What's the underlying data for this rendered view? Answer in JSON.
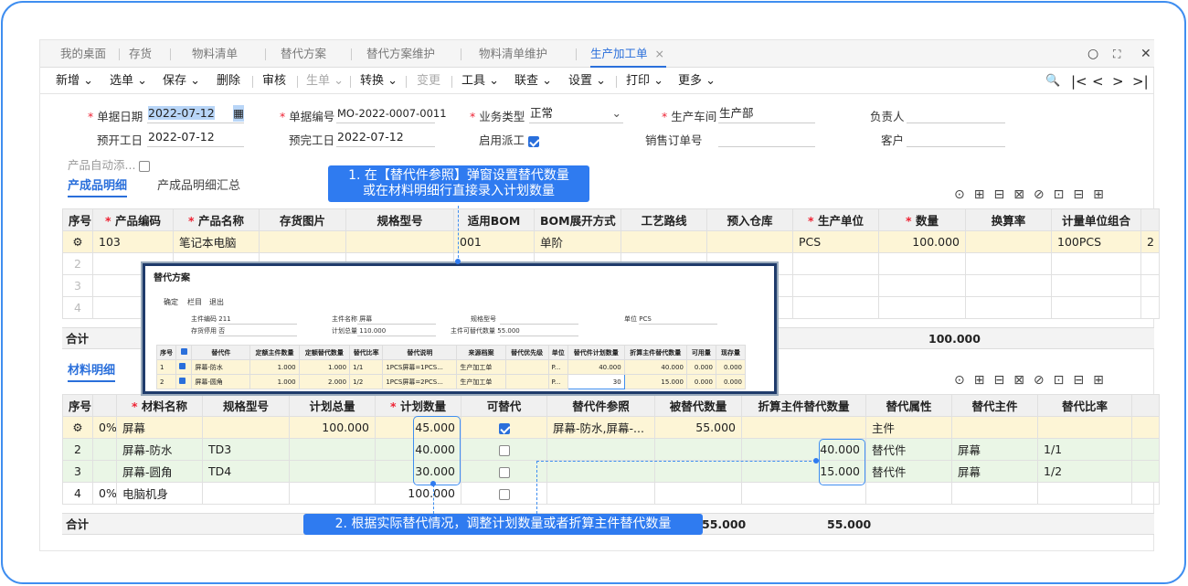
{
  "tabs": [
    {
      "label": "我的桌面"
    },
    {
      "label": "存货"
    },
    {
      "label": "物料清单"
    },
    {
      "label": "替代方案"
    },
    {
      "label": "替代方案维护"
    },
    {
      "label": "物料清单维护"
    },
    {
      "label": "生产加工单"
    }
  ],
  "tab_close": "×",
  "window_controls": {
    "search": "○",
    "maximize": "⛶",
    "close": "✕"
  },
  "toolbar": {
    "new": "新增 ⌄",
    "select": "选单 ⌄",
    "save": "保存 ⌄",
    "delete": "删除",
    "audit": "审核",
    "produce": "生单 ⌄",
    "convert": "转换 ⌄",
    "change": "变更",
    "tools": "工具 ⌄",
    "query": "联查 ⌄",
    "settings": "设置 ⌄",
    "print": "打印 ⌄",
    "more": "更多 ⌄"
  },
  "nav": {
    "find": "🔍",
    "first": "|<",
    "prev": "<",
    "next": ">",
    "last": ">|"
  },
  "form": {
    "doc_date_label": "单据日期",
    "doc_date": "2022-07-12",
    "calendar_icon": "▦",
    "doc_no_label": "单据编号",
    "doc_no": "MO-2022-0007-0011",
    "biz_type_label": "业务类型",
    "biz_type": "正常",
    "workshop_label": "生产车间",
    "workshop": "生产部",
    "owner_label": "负责人",
    "owner": "",
    "start_label": "预开工日",
    "start": "2022-07-12",
    "finish_label": "预完工日",
    "finish": "2022-07-12",
    "dispatch_label": "启用派工",
    "sales_order_label": "销售订单号",
    "sales_order": "",
    "customer_label": "客户",
    "customer": "",
    "auto_add_label": "产品自动添..."
  },
  "product_tabs": {
    "detail": "产成品明细",
    "summary": "产成品明细汇总"
  },
  "product_table": {
    "headers": [
      "序号",
      "产品编码",
      "产品名称",
      "存货图片",
      "规格型号",
      "适用BOM",
      "BOM展开方式",
      "工艺路线",
      "预入仓库",
      "生产单位",
      "数量",
      "换算率",
      "计量单位组合"
    ],
    "rows": [
      {
        "seq": "",
        "code": "103",
        "name": "笔记本电脑",
        "img": "",
        "spec": "",
        "bom": "001",
        "expand": "单阶",
        "route": "",
        "wh": "",
        "unit": "PCS",
        "qty": "100.000",
        "rate": "",
        "combo": "100PCS"
      },
      {
        "seq": "2"
      },
      {
        "seq": "3"
      },
      {
        "seq": "4"
      }
    ],
    "sum_label": "合计",
    "sum_qty": "100.000"
  },
  "popup": {
    "title": "替代方案",
    "buttons": [
      "确定",
      "栏目",
      "退出"
    ],
    "main_code_label": "主件编码",
    "main_code": "211",
    "main_name_label": "主件名称",
    "main_name": "屏幕",
    "spec_label": "规格型号",
    "spec": "",
    "unit_label": "单位",
    "unit": "PCS",
    "stock_label": "存货停用",
    "stock": "否",
    "plan_total_label": "计划总量",
    "plan_total": "110.000",
    "sub_qty_label": "主件可替代数量",
    "sub_qty": "55.000",
    "headers": [
      "序号",
      "",
      "替代件",
      "定额主件数量",
      "定额替代数量",
      "替代比率",
      "替代说明",
      "来源档案",
      "替代优先级",
      "单位",
      "替代件计划数量",
      "折算主件替代数量",
      "可用量",
      "现存量"
    ],
    "rows": [
      {
        "seq": "1",
        "part": "屏幕-防水",
        "q1": "1.000",
        "q2": "1.000",
        "ratio": "1/1",
        "desc": "1PCS屏幕=1PCS...",
        "src": "生产加工单",
        "pri": "",
        "unit": "P...",
        "plan": "40.000",
        "conv": "40.000",
        "avail": "0.000",
        "stock": "0.000"
      },
      {
        "seq": "2",
        "part": "屏幕-圆角",
        "q1": "1.000",
        "q2": "2.000",
        "ratio": "1/2",
        "desc": "1PCS屏幕=2PCS...",
        "src": "生产加工单",
        "pri": "",
        "unit": "P...",
        "plan": "30",
        "conv": "15.000",
        "avail": "0.000",
        "stock": "0.000"
      }
    ]
  },
  "material_tab": "材料明细",
  "material_table": {
    "headers": [
      "序号",
      "",
      "材料名称",
      "规格型号",
      "计划总量",
      "计划数量",
      "可替代",
      "替代件参照",
      "被替代数量",
      "折算主件替代数量",
      "替代属性",
      "替代主件",
      "替代比率"
    ],
    "rows": [
      {
        "seq": "",
        "pct": "0%",
        "name": "屏幕",
        "spec": "",
        "total": "100.000",
        "plan": "45.000",
        "sub": true,
        "ref": "屏幕-防水,屏幕-...",
        "replaced": "55.000",
        "conv": "",
        "attr": "主件",
        "main": "",
        "ratio": ""
      },
      {
        "seq": "2",
        "pct": "",
        "name": "屏幕-防水",
        "spec": "TD3",
        "total": "",
        "plan": "40.000",
        "sub": false,
        "ref": "",
        "replaced": "",
        "conv": "40.000",
        "attr": "替代件",
        "main": "屏幕",
        "ratio": "1/1"
      },
      {
        "seq": "3",
        "pct": "",
        "name": "屏幕-圆角",
        "spec": "TD4",
        "total": "",
        "plan": "30.000",
        "sub": false,
        "ref": "",
        "replaced": "",
        "conv": "15.000",
        "attr": "替代件",
        "main": "屏幕",
        "ratio": "1/2"
      },
      {
        "seq": "4",
        "pct": "0%",
        "name": "电脑机身",
        "spec": "",
        "total": "",
        "plan": "100.000",
        "sub": false,
        "ref": "",
        "replaced": "",
        "conv": "",
        "attr": "",
        "main": "",
        "ratio": ""
      }
    ],
    "sum_label": "合计",
    "sum_replaced": "55.000",
    "sum_conv": "55.000"
  },
  "callouts": {
    "c1_line1": "1. 在【替代件参照】弹窗设置替代数量",
    "c1_line2": "或在材料明细行直接录入计划数量",
    "c2": "2. 根据实际替代情况，调整计划数量或者折算主件替代数量"
  },
  "colors": {
    "accent": "#2f7bf0",
    "frame": "#3f8ef0",
    "row_yellow": "#fdf5d6",
    "row_green": "#eaf6e6"
  }
}
